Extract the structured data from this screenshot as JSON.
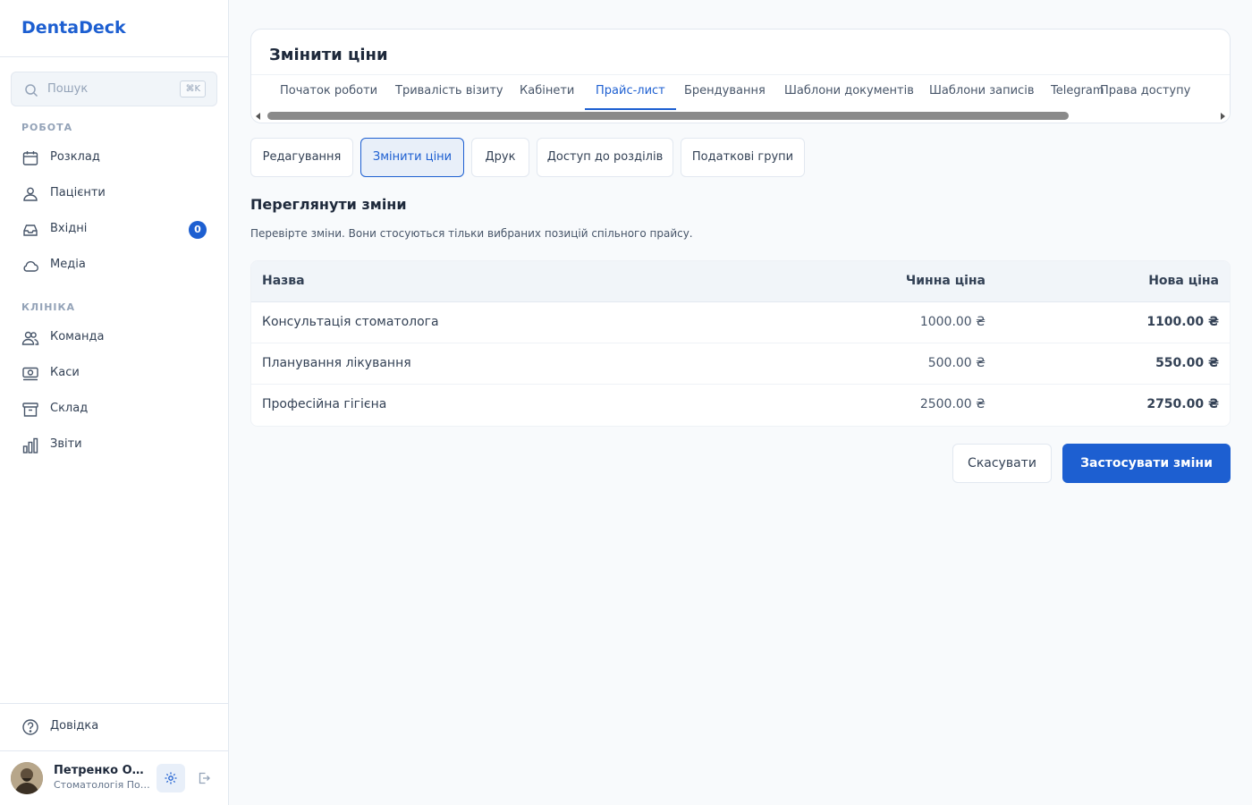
{
  "app": {
    "brand": "DentaDeck"
  },
  "search": {
    "placeholder": "Пошук",
    "shortcut": "⌘K"
  },
  "sidebar": {
    "sections": [
      {
        "label": "РОБОТА"
      },
      {
        "label": "КЛІНІКА"
      }
    ],
    "items": [
      {
        "label": "Розклад",
        "icon": "calendar-icon"
      },
      {
        "label": "Пацієнти",
        "icon": "patients-icon"
      },
      {
        "label": "Вхідні",
        "icon": "inbox-icon",
        "badge": "0"
      },
      {
        "label": "Медіа",
        "icon": "cloud-icon"
      },
      {
        "label": "Команда",
        "icon": "team-icon"
      },
      {
        "label": "Каси",
        "icon": "cash-register-icon"
      },
      {
        "label": "Склад",
        "icon": "archive-icon"
      },
      {
        "label": "Звіти",
        "icon": "bar-chart-icon"
      }
    ],
    "help": {
      "label": "Довідка",
      "icon": "help-circle-icon"
    },
    "user": {
      "name": "Петренко Олександр",
      "org": "Стоматологія Посмішка"
    }
  },
  "card": {
    "title": "Змінити ціни",
    "tabs": [
      {
        "label": "Початок роботи"
      },
      {
        "label": "Тривалість візиту"
      },
      {
        "label": "Кабінети"
      },
      {
        "label": "Прайс-лист",
        "active": true
      },
      {
        "label": "Брендування"
      },
      {
        "label": "Шаблони документів"
      },
      {
        "label": "Шаблони записів"
      },
      {
        "label": "Telegram"
      },
      {
        "label": "Права доступу"
      }
    ]
  },
  "subtabs": [
    {
      "label": "Редагування"
    },
    {
      "label": "Змінити ціни",
      "active": true
    },
    {
      "label": "Друк"
    },
    {
      "label": "Доступ до розділів"
    },
    {
      "label": "Податкові групи"
    }
  ],
  "review": {
    "title": "Переглянути зміни",
    "description": "Перевірте зміни. Вони стосуються тільки вибраних позицій спільного прайсу."
  },
  "table": {
    "headers": {
      "name": "Назва",
      "current": "Чинна ціна",
      "new": "Нова ціна"
    },
    "rows": [
      {
        "name": "Консультація стоматолога",
        "current": "1000.00 ₴",
        "new": "1100.00 ₴"
      },
      {
        "name": "Планування лікування",
        "current": "500.00 ₴",
        "new": "550.00 ₴"
      },
      {
        "name": "Професійна гігієна",
        "current": "2500.00 ₴",
        "new": "2750.00 ₴"
      }
    ]
  },
  "actions": {
    "cancel": "Скасувати",
    "apply": "Застосувати зміни"
  },
  "colors": {
    "accent": "#1d5fd1",
    "background": "#f8fafc",
    "border": "#e2e8f0"
  }
}
